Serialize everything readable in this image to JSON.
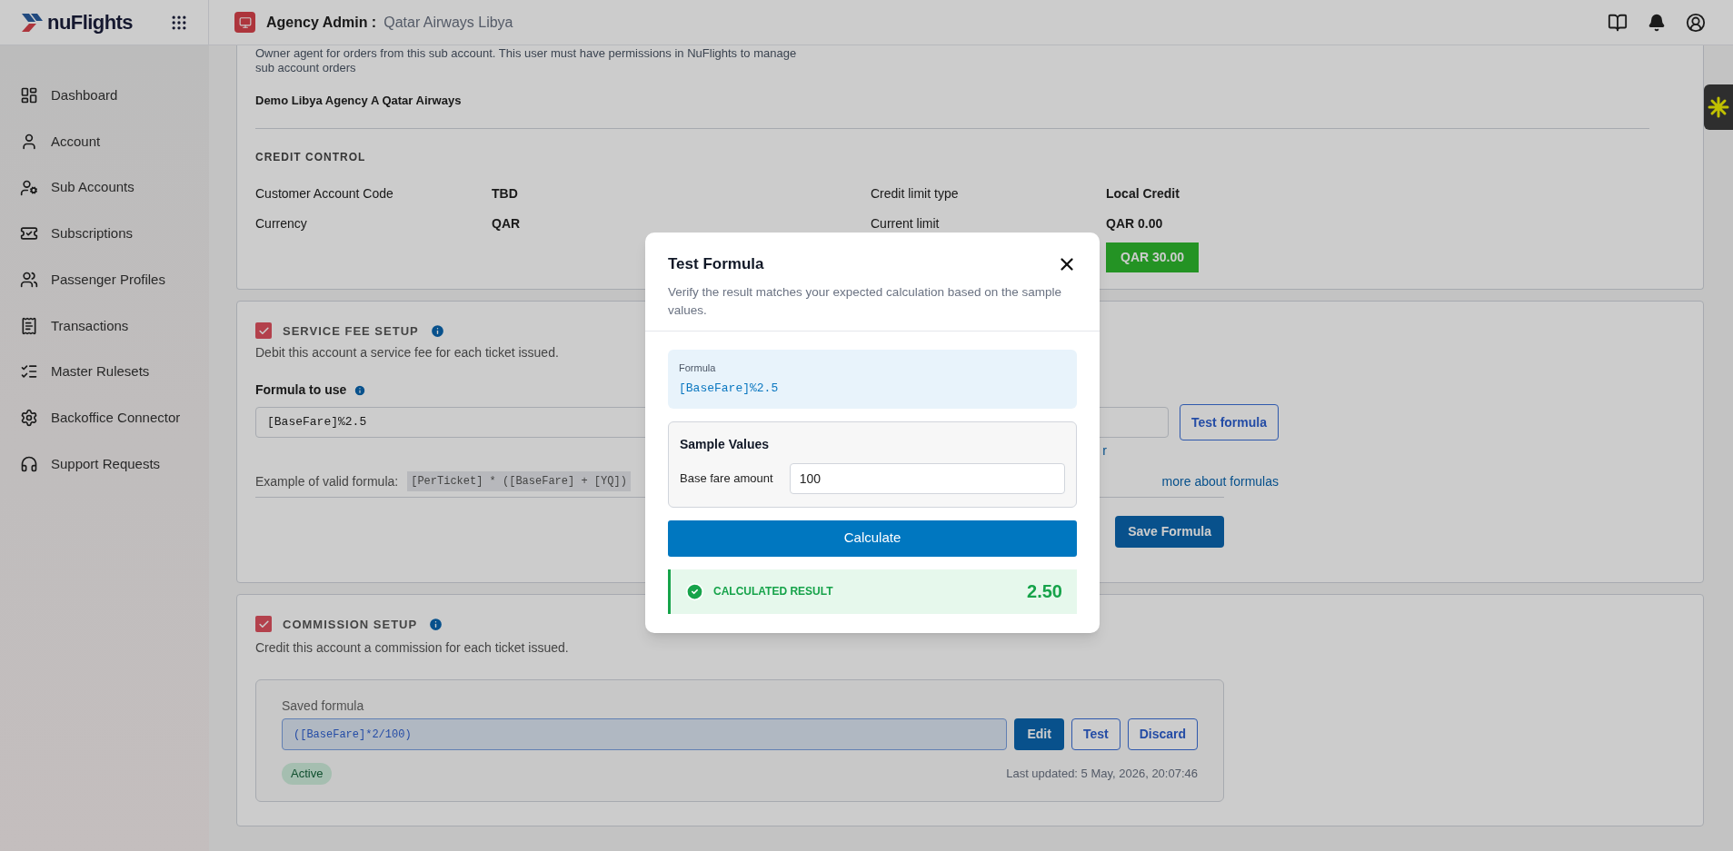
{
  "header": {
    "logo": "nuFlights",
    "title": "Agency Admin :",
    "subtitle": "Qatar Airways Libya"
  },
  "sidebar": {
    "items": [
      {
        "label": "Dashboard"
      },
      {
        "label": "Account"
      },
      {
        "label": "Sub Accounts"
      },
      {
        "label": "Subscriptions"
      },
      {
        "label": "Passenger Profiles"
      },
      {
        "label": "Transactions"
      },
      {
        "label": "Master Rulesets"
      },
      {
        "label": "Backoffice Connector"
      },
      {
        "label": "Support Requests"
      }
    ]
  },
  "owner": {
    "description": "Owner agent for orders from this sub account. This user must have permissions in NuFlights to manage sub account orders",
    "value": "Demo Libya Agency A Qatar Airways"
  },
  "credit_control": {
    "title": "CREDIT CONTROL",
    "rows": [
      {
        "label": "Customer Account Code",
        "value": "TBD",
        "label_2": "Credit limit type",
        "value_2": "Local Credit"
      },
      {
        "label": "Currency",
        "value": "QAR",
        "label_2": "Current limit",
        "value_2": "QAR 0.00"
      }
    ],
    "limit_badge": "QAR 30.00"
  },
  "service_fee": {
    "checked": true,
    "title": "SERVICE FEE SETUP",
    "description": "Debit this account a service fee for each ticket issued.",
    "formula_label": "Formula to use",
    "formula_value": "[BaseFare]%2.5",
    "test_button": "Test formula",
    "link_fragment": "r",
    "example_label": "Example of valid formula:",
    "example_code": "[PerTicket] * ([BaseFare] + [YQ])",
    "learn_link": "more about formulas",
    "save_button": "Save Formula"
  },
  "commission": {
    "checked": true,
    "title": "COMMISSION SETUP",
    "description": "Credit this account a commission for each ticket issued.",
    "saved_label": "Saved formula",
    "formula": "([BaseFare]*2/100)",
    "buttons": [
      "Edit",
      "Test",
      "Discard"
    ],
    "status": "Active",
    "last_updated": "Last updated: 5 May, 2026, 20:07:46"
  },
  "modal": {
    "title": "Test Formula",
    "subtitle": "Verify the result matches your expected calculation based on the sample values.",
    "formula_label": "Formula",
    "formula": "[BaseFare]%2.5",
    "sample_title": "Sample Values",
    "field_label": "Base fare amount",
    "field_value": "100",
    "button": "Calculate",
    "result_label": "CALCULATED RESULT",
    "result_value": "2.50"
  }
}
